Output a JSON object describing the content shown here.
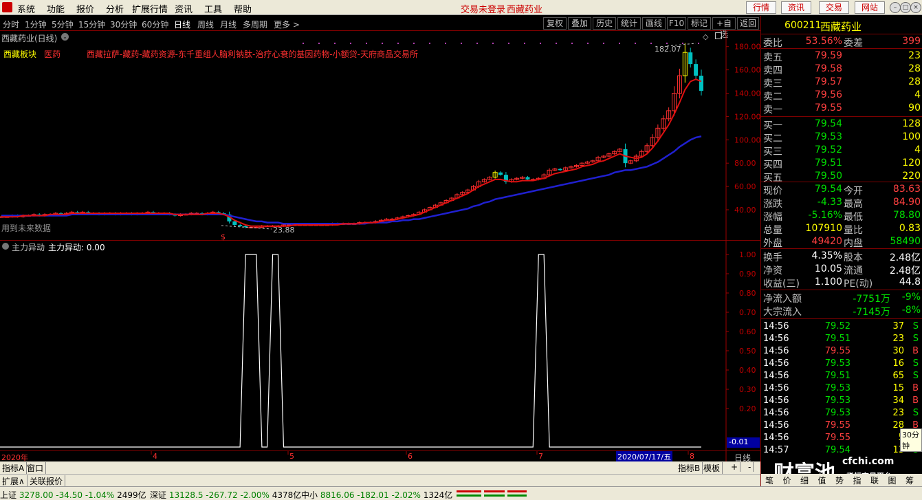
{
  "menubar": {
    "items": [
      "系统",
      "功能",
      "报价",
      "分析",
      "扩展行情",
      "资讯",
      "工具",
      "帮助"
    ],
    "status": "交易未登录",
    "stock_name": "西藏药业",
    "nav_buttons": [
      "行情",
      "资讯",
      "交易",
      "网站"
    ],
    "window_buttons": [
      "–",
      "□",
      "×"
    ]
  },
  "toolbar": {
    "periods": [
      "分时",
      "1分钟",
      "5分钟",
      "15分钟",
      "30分钟",
      "60分钟",
      "日线",
      "周线",
      "月线",
      "多周期",
      "更多 >"
    ],
    "active_period": "日线",
    "buttons": [
      "复权",
      "叠加",
      "历史",
      "统计",
      "画线",
      "F10",
      "标记",
      "+自选",
      "返回"
    ]
  },
  "main_chart": {
    "title": "西藏药业(日线)",
    "sector_label": "西藏板块",
    "industry_label": "医药",
    "concepts": "西藏拉萨-藏药-藏药资源-东千重组人脑利钠肽-治疗心衰的基因药物-小额贷-天府商品交易所",
    "future_data_note": "用到未来数据",
    "high_label": "182.07",
    "low_label": "23.88",
    "signal_mark": "$"
  },
  "sub_chart": {
    "title": "主力异动",
    "value_label": "主力异动: 0.00",
    "current_value": "-0.01"
  },
  "date_axis": {
    "labels": [
      "2020年",
      "4",
      "5",
      "6",
      "7",
      "8"
    ],
    "cursor_date": "2020/07/17/五",
    "period_label": "日线"
  },
  "tabs_row1": [
    "指标A",
    "窗口"
  ],
  "tabs_row1_right": [
    "指标B",
    "模板",
    "+",
    "-"
  ],
  "tabs_row2": [
    "扩展∧",
    "关联报价"
  ],
  "index_bar": [
    {
      "name": "上证",
      "value": "3278.00",
      "change": "-34.50",
      "pct": "-1.04%",
      "amount": "2499亿"
    },
    {
      "name": "深证",
      "value": "13128.5",
      "change": "-267.72",
      "pct": "-2.00%",
      "amount": "4378亿"
    },
    {
      "name": "中小",
      "value": "8816.06",
      "change": "-182.01",
      "pct": "-2.02%",
      "amount": "1324亿"
    }
  ],
  "quote": {
    "code": "600211",
    "name": "西藏药业",
    "weibi_label": "委比",
    "weibi": "53.56%",
    "weicha_label": "委差",
    "weicha": "399",
    "asks": [
      {
        "label": "卖五",
        "price": "79.59",
        "vol": "23"
      },
      {
        "label": "卖四",
        "price": "79.58",
        "vol": "28"
      },
      {
        "label": "卖三",
        "price": "79.57",
        "vol": "28"
      },
      {
        "label": "卖二",
        "price": "79.56",
        "vol": "4"
      },
      {
        "label": "卖一",
        "price": "79.55",
        "vol": "90"
      }
    ],
    "bids": [
      {
        "label": "买一",
        "price": "79.54",
        "vol": "128"
      },
      {
        "label": "买二",
        "price": "79.53",
        "vol": "100"
      },
      {
        "label": "买三",
        "price": "79.52",
        "vol": "4"
      },
      {
        "label": "买四",
        "price": "79.51",
        "vol": "120"
      },
      {
        "label": "买五",
        "price": "79.50",
        "vol": "220"
      }
    ],
    "stats": [
      {
        "l1": "现价",
        "v1": "79.54",
        "l2": "今开",
        "v2": "83.63"
      },
      {
        "l1": "涨跌",
        "v1": "-4.33",
        "l2": "最高",
        "v2": "84.90"
      },
      {
        "l1": "涨幅",
        "v1": "-5.16%",
        "l2": "最低",
        "v2": "78.80"
      },
      {
        "l1": "总量",
        "v1": "107910",
        "l2": "量比",
        "v2": "0.83"
      },
      {
        "l1": "外盘",
        "v1": "49420",
        "l2": "内盘",
        "v2": "58490"
      }
    ],
    "fund": [
      {
        "l1": "换手",
        "v1": "4.35%",
        "l2": "股本",
        "v2": "2.48亿"
      },
      {
        "l1": "净资",
        "v1": "10.05",
        "l2": "流通",
        "v2": "2.48亿"
      },
      {
        "l1": "收益(三)",
        "v1": "1.100",
        "l2": "PE(动)",
        "v2": "44.8"
      }
    ],
    "flows": [
      {
        "label": "净流入额",
        "value": "-7751万",
        "pct": "-9%"
      },
      {
        "label": "大宗流入",
        "value": "-7145万",
        "pct": "-8%"
      }
    ],
    "ticks": [
      {
        "time": "14:56",
        "price": "79.52",
        "vol": "37",
        "side": "S"
      },
      {
        "time": "14:56",
        "price": "79.51",
        "vol": "23",
        "side": "S"
      },
      {
        "time": "14:56",
        "price": "79.55",
        "vol": "30",
        "side": "B"
      },
      {
        "time": "14:56",
        "price": "79.53",
        "vol": "16",
        "side": "S"
      },
      {
        "time": "14:56",
        "price": "79.51",
        "vol": "65",
        "side": "S"
      },
      {
        "time": "14:56",
        "price": "79.53",
        "vol": "15",
        "side": "B"
      },
      {
        "time": "14:56",
        "price": "79.53",
        "vol": "34",
        "side": "B"
      },
      {
        "time": "14:56",
        "price": "79.53",
        "vol": "23",
        "side": "S"
      },
      {
        "time": "14:56",
        "price": "79.55",
        "vol": "28",
        "side": "B"
      },
      {
        "time": "14:56",
        "price": "79.55",
        "vol": "5",
        "side": ""
      },
      {
        "time": "14:57",
        "price": "79.54",
        "vol": "13",
        "side": "S"
      }
    ],
    "tooltip": "30分钟",
    "bottom_tabs": [
      "笔",
      "价",
      "细",
      "值",
      "势",
      "指",
      "联",
      "图",
      "筹"
    ],
    "watermark_main": "财富池",
    "watermark_url": "cfchi.com",
    "watermark_sub": "指标交易平台"
  },
  "chart_data": [
    {
      "type": "candlestick",
      "title": "西藏药业(日线)",
      "y_ticks": [
        40.0,
        60.0,
        80.0,
        100.0,
        120.0,
        140.0,
        160.0,
        180.0
      ],
      "ylim": [
        23.88,
        182.07
      ],
      "x_labels": [
        "2020年",
        "4",
        "5",
        "6",
        "7",
        "8"
      ],
      "close": [
        34,
        34,
        35,
        34,
        35,
        35,
        36,
        35,
        36,
        36,
        37,
        36,
        37,
        38,
        37,
        38,
        37,
        37,
        36,
        37,
        37,
        36,
        37,
        37,
        36,
        37,
        37,
        38,
        37,
        37,
        37,
        36,
        35,
        36,
        36,
        37,
        37,
        36,
        37,
        38,
        37,
        36,
        30,
        27,
        26,
        25,
        25,
        25,
        26,
        26,
        26,
        26,
        27,
        27,
        27,
        27,
        27,
        27,
        27,
        27,
        27,
        28,
        28,
        28,
        28,
        28,
        29,
        29,
        29,
        30,
        31,
        32,
        32,
        33,
        34,
        35,
        36,
        38,
        40,
        42,
        44,
        46,
        48,
        50,
        53,
        55,
        57,
        60,
        64,
        66,
        68,
        72,
        70,
        64,
        66,
        67,
        68,
        66,
        66,
        67,
        70,
        74,
        75,
        74,
        76,
        77,
        78,
        80,
        81,
        82,
        85,
        86,
        88,
        90,
        92,
        80,
        82,
        86,
        90,
        95,
        102,
        110,
        118,
        125,
        140,
        155,
        175,
        165,
        155,
        142
      ],
      "ma_short": [
        34,
        34,
        34,
        34,
        35,
        35,
        35,
        35,
        35,
        36,
        36,
        36,
        36,
        37,
        37,
        37,
        37,
        37,
        37,
        37,
        37,
        37,
        37,
        37,
        37,
        37,
        37,
        37,
        37,
        37,
        37,
        37,
        36,
        36,
        36,
        36,
        36,
        36,
        37,
        37,
        37,
        36,
        34,
        31,
        29,
        27,
        26,
        26,
        26,
        26,
        26,
        26,
        26,
        26,
        27,
        27,
        27,
        27,
        27,
        27,
        27,
        27,
        27,
        28,
        28,
        28,
        28,
        29,
        29,
        29,
        30,
        31,
        31,
        32,
        33,
        34,
        35,
        36,
        38,
        40,
        42,
        44,
        46,
        48,
        50,
        52,
        54,
        57,
        60,
        62,
        64,
        66,
        66,
        65,
        64,
        64,
        65,
        65,
        65,
        66,
        67,
        69,
        71,
        72,
        73,
        74,
        75,
        77,
        78,
        79,
        81,
        82,
        84,
        86,
        88,
        86,
        85,
        84,
        85,
        88,
        93,
        99,
        106,
        113,
        122,
        132,
        143,
        150,
        152,
        150
      ],
      "ma_long": [
        35,
        35,
        35,
        35,
        35,
        35,
        35,
        35,
        35,
        35,
        35,
        35,
        35,
        36,
        36,
        36,
        36,
        36,
        36,
        36,
        36,
        36,
        36,
        36,
        36,
        36,
        36,
        36,
        36,
        36,
        36,
        36,
        36,
        36,
        36,
        36,
        36,
        36,
        36,
        36,
        36,
        36,
        35,
        34,
        33,
        32,
        31,
        30,
        30,
        29,
        29,
        29,
        28,
        28,
        28,
        28,
        28,
        28,
        28,
        28,
        28,
        28,
        28,
        28,
        28,
        28,
        28,
        28,
        29,
        29,
        29,
        29,
        30,
        30,
        31,
        31,
        32,
        32,
        33,
        34,
        35,
        36,
        37,
        38,
        39,
        40,
        41,
        43,
        44,
        46,
        47,
        49,
        50,
        51,
        52,
        53,
        54,
        55,
        56,
        57,
        58,
        59,
        60,
        61,
        62,
        63,
        64,
        65,
        66,
        67,
        68,
        69,
        70,
        72,
        73,
        74,
        74,
        75,
        76,
        77,
        79,
        81,
        84,
        87,
        90,
        94,
        97,
        100,
        102,
        103
      ]
    },
    {
      "type": "line",
      "title": "主力异动",
      "y_ticks": [
        0.2,
        0.3,
        0.4,
        0.5,
        0.6,
        0.7,
        0.8,
        0.9,
        1.0
      ],
      "ylim": [
        -0.01,
        1.0
      ],
      "pulses": [
        {
          "start_bar": 45,
          "end_bar": 47,
          "value": 1.0
        },
        {
          "start_bar": 50,
          "end_bar": 51,
          "value": 1.0
        },
        {
          "start_bar": 99,
          "end_bar": 100,
          "value": 1.0
        }
      ],
      "current_value": 0.0
    }
  ]
}
